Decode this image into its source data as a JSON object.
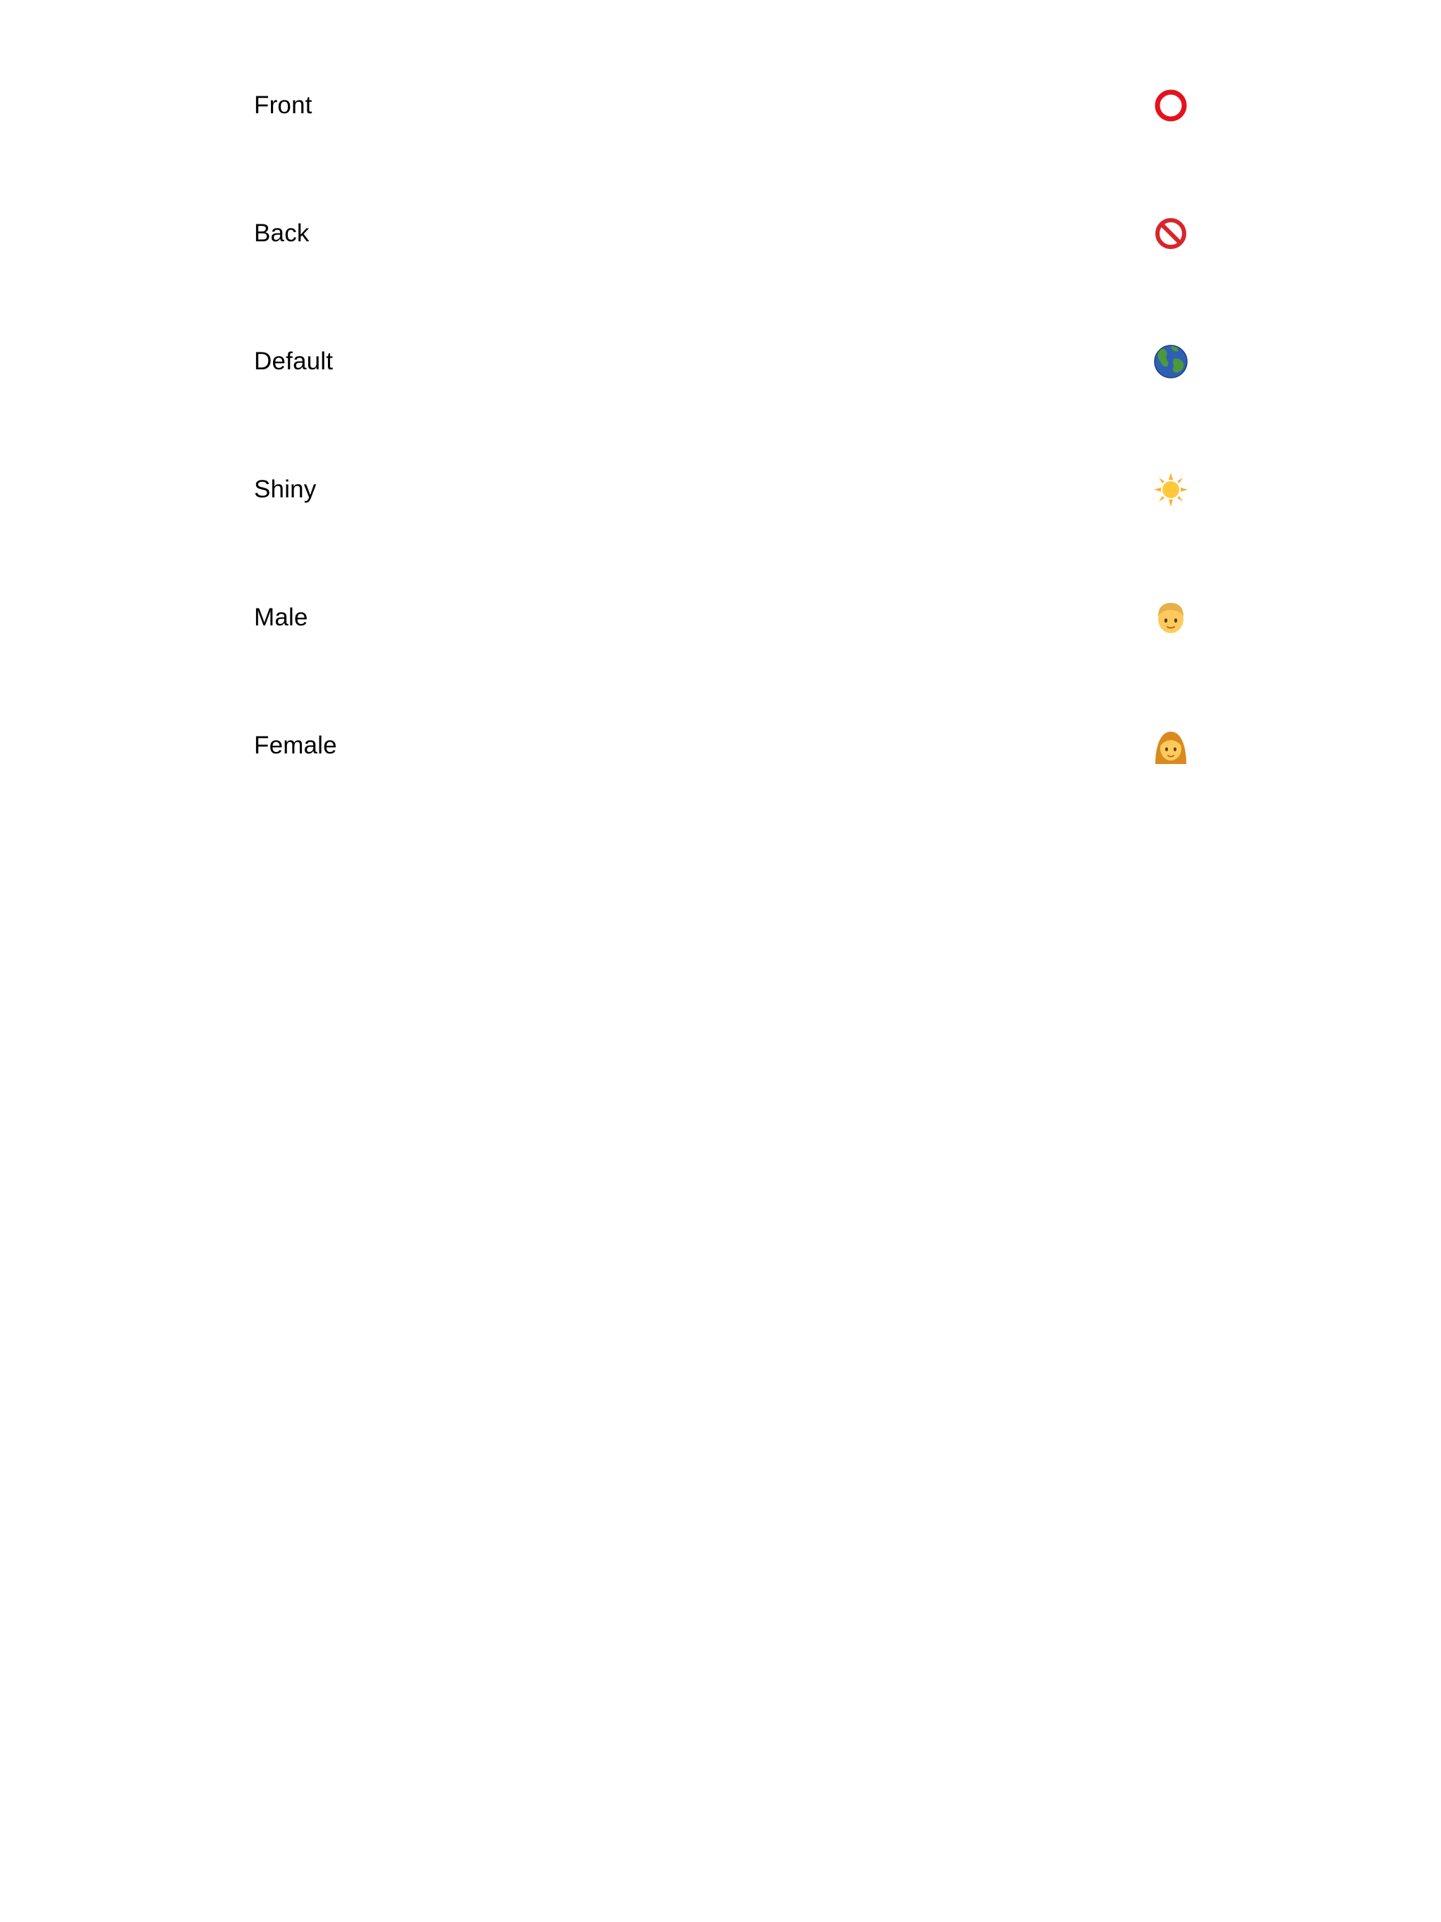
{
  "options": [
    {
      "label": "Front",
      "icon": "hollow-red-circle-icon"
    },
    {
      "label": "Back",
      "icon": "prohibited-icon"
    },
    {
      "label": "Default",
      "icon": "globe-icon"
    },
    {
      "label": "Shiny",
      "icon": "sun-icon"
    },
    {
      "label": "Male",
      "icon": "boy-face-icon"
    },
    {
      "label": "Female",
      "icon": "woman-face-icon"
    }
  ],
  "colors": {
    "background": "#ffffff",
    "text": "#000000",
    "circle_red": "#e3121e",
    "globe_ocean": "#2f5fb3",
    "globe_land": "#4a9a3c",
    "sun_yellow": "#ffc83a",
    "skin": "#ffca5c",
    "hair_light": "#e8b04a",
    "hair_dark": "#d98a1e"
  }
}
